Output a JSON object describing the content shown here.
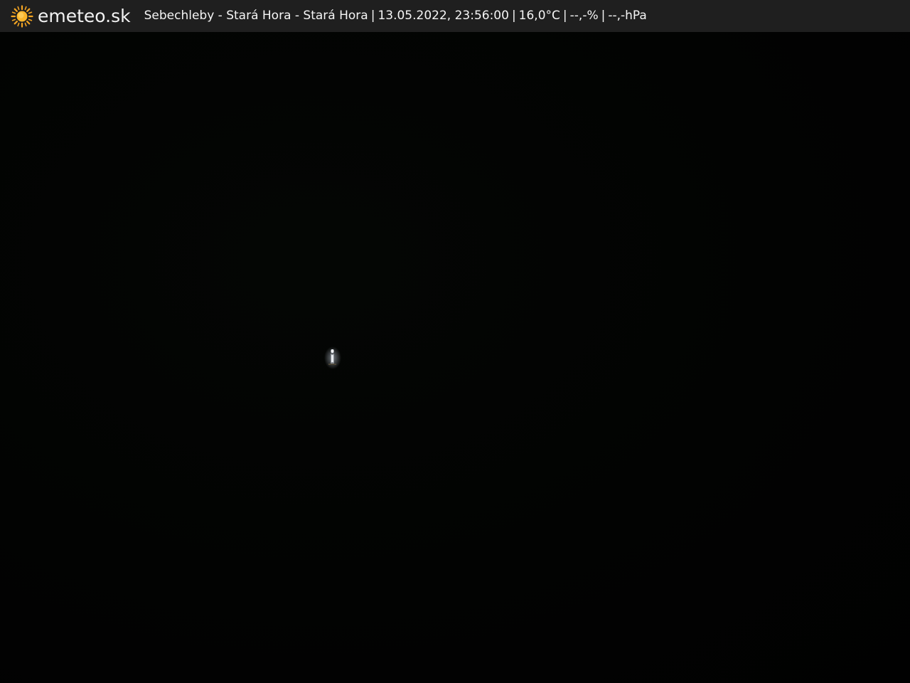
{
  "header": {
    "brand": "emeteo.sk",
    "logo_icon": "sun-icon",
    "location": "Sebechleby - Stará Hora - Stará Hora",
    "datetime": "13.05.2022, 23:56:00",
    "temperature": "16,0°C",
    "humidity": "--,-%",
    "pressure": "--,-hPa",
    "separator": "|"
  },
  "colors": {
    "bar_background": "#1f1f1f",
    "text": "#f5f5f5",
    "sun": "#f6a623",
    "sky": "#020302"
  },
  "scene": {
    "light_icon": "light-source-icon"
  }
}
